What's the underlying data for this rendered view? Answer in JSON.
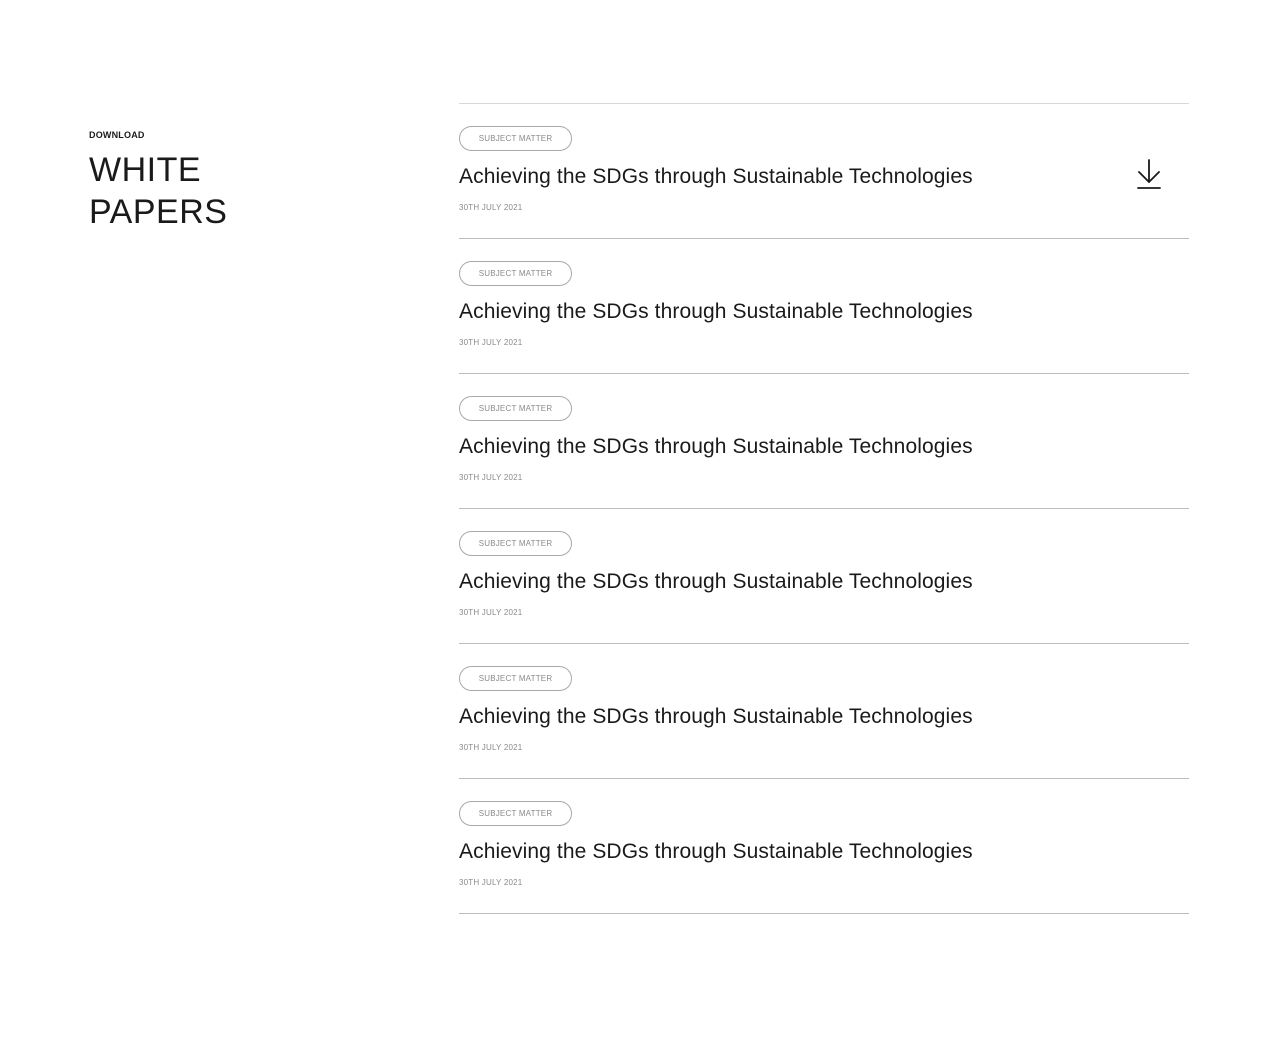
{
  "section": {
    "eyebrow": "DOWNLOAD",
    "title_line1": "WHITE",
    "title_line2": "PAPERS"
  },
  "papers": [
    {
      "tag": "SUBJECT MATTER",
      "title": "Achieving the SDGs through Sustainable Technologies",
      "date": "30TH JULY 2021",
      "download_icon": "download-arrow-icon"
    },
    {
      "tag": "SUBJECT MATTER",
      "title": "Achieving the SDGs through Sustainable Technologies",
      "date": "30TH JULY 2021"
    },
    {
      "tag": "SUBJECT MATTER",
      "title": "Achieving the SDGs through Sustainable Technologies",
      "date": "30TH JULY 2021"
    },
    {
      "tag": "SUBJECT MATTER",
      "title": "Achieving the SDGs through Sustainable Technologies",
      "date": "30TH JULY 2021"
    },
    {
      "tag": "SUBJECT MATTER",
      "title": "Achieving the SDGs through Sustainable Technologies",
      "date": "30TH JULY 2021"
    },
    {
      "tag": "SUBJECT MATTER",
      "title": "Achieving the SDGs through Sustainable Technologies",
      "date": "30TH JULY 2021"
    }
  ],
  "colors": {
    "text": "#1a1a1a",
    "muted": "#8a8a8a",
    "divider": "#bdbdbd",
    "tag_border": "#a9a9a9"
  }
}
